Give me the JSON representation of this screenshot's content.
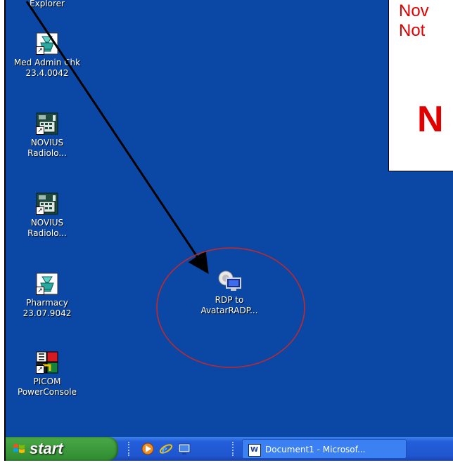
{
  "colors": {
    "desktop": "#0b48a6",
    "notice_text": "#e00000",
    "annotation_circle": "#c62828",
    "arrow": "#000000"
  },
  "desktop_icons": [
    {
      "label_lines": [
        "Explorer"
      ],
      "icon": "explorer-icon"
    },
    {
      "label_lines": [
        "Med Admin Chk",
        "23.4.0042"
      ],
      "icon": "mortar-pestle-icon"
    },
    {
      "label_lines": [
        "NOVIUS",
        "Radiolo..."
      ],
      "icon": "novius-radiology-icon"
    },
    {
      "label_lines": [
        "NOVIUS",
        "Radiolo..."
      ],
      "icon": "novius-radiology-icon"
    },
    {
      "label_lines": [
        "Pharmacy",
        "23.07.9042"
      ],
      "icon": "mortar-pestle-icon"
    },
    {
      "label_lines": [
        "PICOM",
        "PowerConsole"
      ],
      "icon": "picom-icon"
    },
    {
      "label_lines": [
        "RDP to",
        "AvatarRADP..."
      ],
      "icon": "remote-desktop-icon"
    }
  ],
  "notice": {
    "line1": "Nov",
    "line2": "Not",
    "big": "N"
  },
  "taskbar": {
    "start_label": "start",
    "quick_launch": [
      "media-player-icon",
      "internet-explorer-icon",
      "show-desktop-icon"
    ],
    "tasks": [
      {
        "label": "Document1 - Microsof...",
        "icon": "word-document-icon"
      }
    ]
  }
}
